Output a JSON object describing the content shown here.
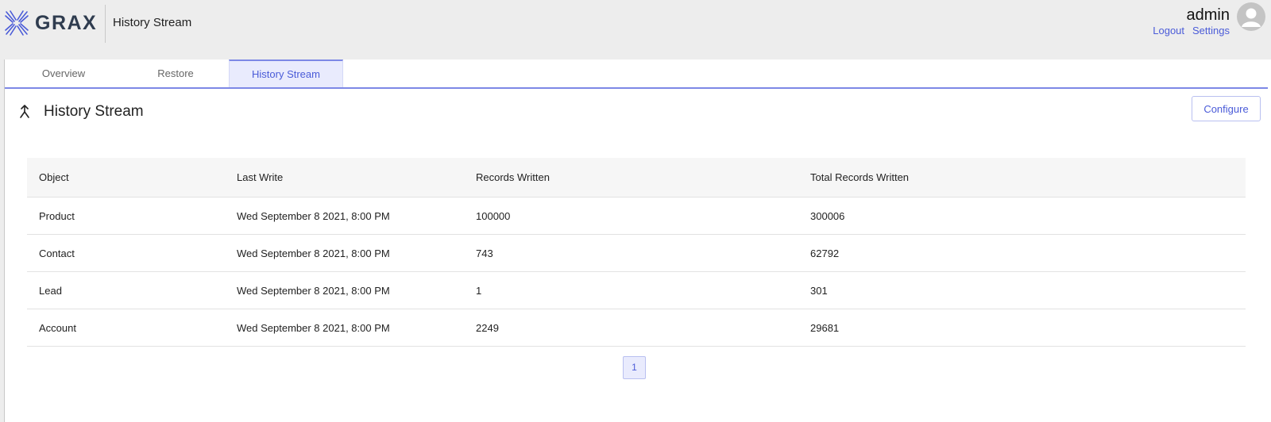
{
  "header": {
    "brand": "GRAX",
    "app_title": "History Stream",
    "username": "admin",
    "logout_label": "Logout",
    "settings_label": "Settings"
  },
  "tabs": [
    {
      "label": "Overview",
      "active": false
    },
    {
      "label": "Restore",
      "active": false
    },
    {
      "label": "History Stream",
      "active": true
    }
  ],
  "section": {
    "title": "History Stream",
    "configure_label": "Configure"
  },
  "table": {
    "columns": [
      "Object",
      "Last Write",
      "Records Written",
      "Total Records Written"
    ],
    "rows": [
      [
        "Product",
        "Wed September 8 2021, 8:00 PM",
        "100000",
        "300006"
      ],
      [
        "Contact",
        "Wed September 8 2021, 8:00 PM",
        "743",
        "62792"
      ],
      [
        "Lead",
        "Wed September 8 2021, 8:00 PM",
        "1",
        "301"
      ],
      [
        "Account",
        "Wed September 8 2021, 8:00 PM",
        "2249",
        "29681"
      ]
    ]
  },
  "pagination": {
    "current_page": "1"
  },
  "colors": {
    "accent": "#4a5bd8",
    "tab_active_bg": "#e9ebfd",
    "brand_text": "#2f3c4f"
  }
}
